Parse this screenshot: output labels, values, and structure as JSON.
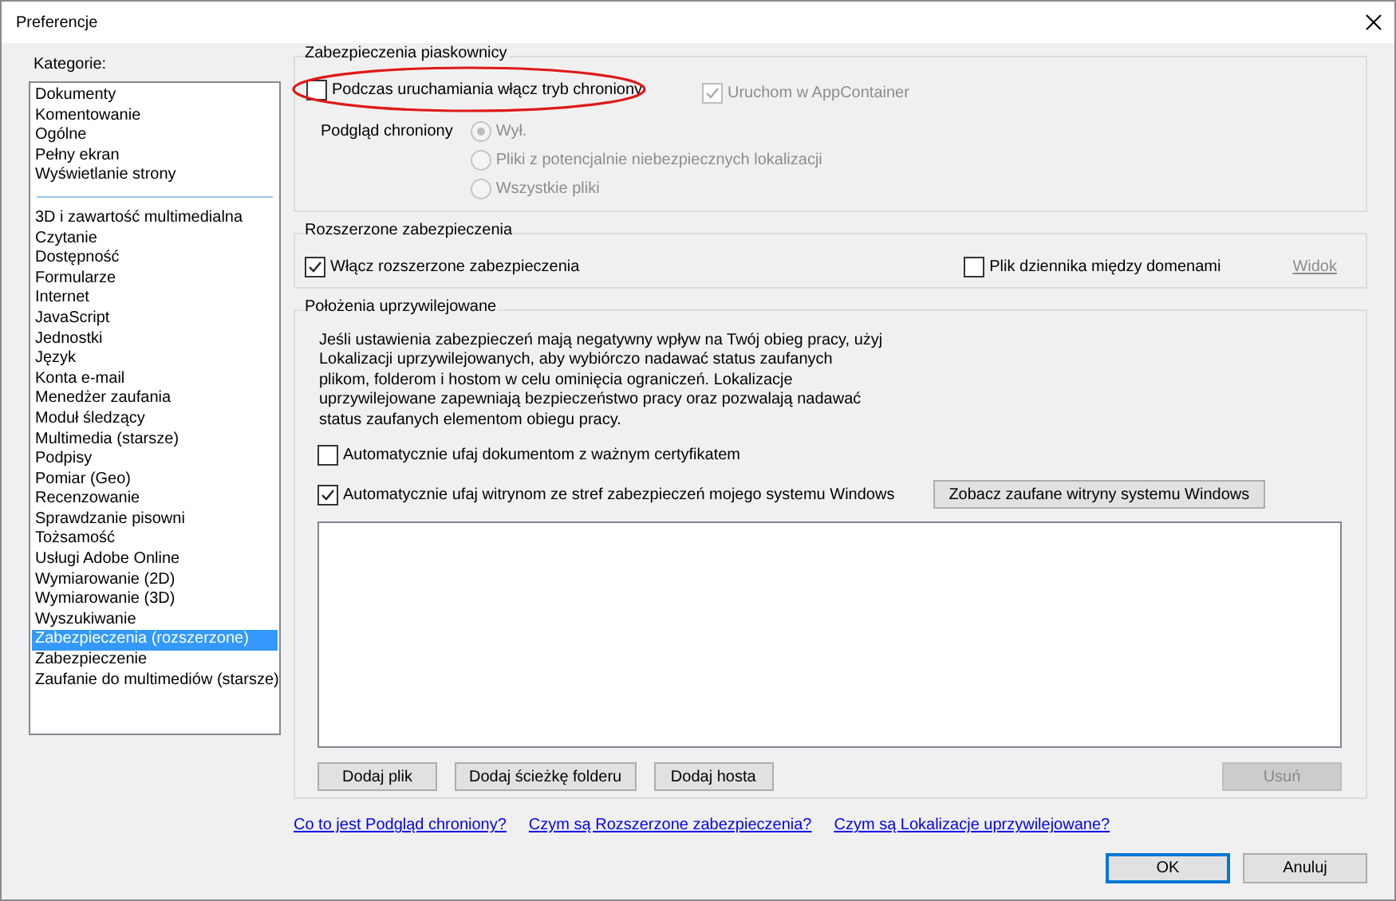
{
  "window": {
    "title": "Preferencje"
  },
  "categories": {
    "label": "Kategorie:",
    "groups": [
      [
        {
          "label": "Dokumenty",
          "selected": false
        },
        {
          "label": "Komentowanie",
          "selected": false
        },
        {
          "label": "Ogólne",
          "selected": false
        },
        {
          "label": "Pełny ekran",
          "selected": false
        },
        {
          "label": "Wyświetlanie strony",
          "selected": false
        }
      ],
      [
        {
          "label": "3D i zawartość multimedialna",
          "selected": false
        },
        {
          "label": "Czytanie",
          "selected": false
        },
        {
          "label": "Dostępność",
          "selected": false
        },
        {
          "label": "Formularze",
          "selected": false
        },
        {
          "label": "Internet",
          "selected": false
        },
        {
          "label": "JavaScript",
          "selected": false
        },
        {
          "label": "Jednostki",
          "selected": false
        },
        {
          "label": "Język",
          "selected": false
        },
        {
          "label": "Konta e-mail",
          "selected": false
        },
        {
          "label": "Menedżer zaufania",
          "selected": false
        },
        {
          "label": "Moduł śledzący",
          "selected": false
        },
        {
          "label": "Multimedia (starsze)",
          "selected": false
        },
        {
          "label": "Podpisy",
          "selected": false
        },
        {
          "label": "Pomiar (Geo)",
          "selected": false
        },
        {
          "label": "Recenzowanie",
          "selected": false
        },
        {
          "label": "Sprawdzanie pisowni",
          "selected": false
        },
        {
          "label": "Tożsamość",
          "selected": false
        },
        {
          "label": "Usługi Adobe Online",
          "selected": false
        },
        {
          "label": "Wymiarowanie (2D)",
          "selected": false
        },
        {
          "label": "Wymiarowanie (3D)",
          "selected": false
        },
        {
          "label": "Wyszukiwanie",
          "selected": false
        },
        {
          "label": "Zabezpieczenia (rozszerzone)",
          "selected": true
        },
        {
          "label": "Zabezpieczenie",
          "selected": false
        },
        {
          "label": "Zaufanie do multimediów (starsze)",
          "selected": false
        }
      ]
    ]
  },
  "sandbox": {
    "title": "Zabezpieczenia piaskownicy",
    "protected_mode": {
      "label": "Podczas uruchamiania włącz tryb chroniony",
      "checked": false,
      "disabled": false,
      "highlighted": true
    },
    "appcontainer": {
      "label": "Uruchom w AppContainer",
      "checked": true,
      "disabled": true
    },
    "preview": {
      "label": "Podgląd chroniony",
      "options": [
        {
          "label": "Wył.",
          "selected": true,
          "disabled": true
        },
        {
          "label": "Pliki z potencjalnie niebezpiecznych lokalizacji",
          "selected": false,
          "disabled": true
        },
        {
          "label": "Wszystkie pliki",
          "selected": false,
          "disabled": true
        }
      ]
    }
  },
  "enhanced": {
    "title": "Rozszerzone zabezpieczenia",
    "enable": {
      "label": "Włącz rozszerzone zabezpieczenia",
      "checked": true,
      "disabled": false
    },
    "log": {
      "label": "Plik dziennika między domenami",
      "checked": false,
      "disabled": false
    },
    "view_link": {
      "label": "Widok",
      "disabled": true
    }
  },
  "privileged": {
    "title": "Położenia uprzywilejowane",
    "description": "Jeśli ustawienia zabezpieczeń mają negatywny wpływ na Twój obieg pracy, użyj Lokalizacji uprzywilejowanych, aby wybiórczo nadawać status zaufanych plikom, folderom i hostom w celu ominięcia ograniczeń. Lokalizacje uprzywilejowane zapewniają bezpieczeństwo pracy oraz pozwalają nadawać status zaufanych elementom obiegu pracy.",
    "certified": {
      "label": "Automatycznie ufaj dokumentom z ważnym certyfikatem",
      "checked": false,
      "disabled": false
    },
    "windows_zones": {
      "label": "Automatycznie ufaj witrynom ze stref zabezpieczeń mojego systemu Windows",
      "checked": true,
      "disabled": false
    },
    "windows_button": "Zobacz zaufane witryny systemu Windows",
    "buttons": [
      {
        "label": "Dodaj plik",
        "disabled": false
      },
      {
        "label": "Dodaj ścieżkę folderu",
        "disabled": false
      },
      {
        "label": "Dodaj hosta",
        "disabled": false
      },
      {
        "label": "Usuń",
        "disabled": true
      }
    ]
  },
  "links": [
    "Co to jest Podgląd chroniony?",
    "Czym są Rozszerzone zabezpieczenia?",
    "Czym są Lokalizacje uprzywilejowane?"
  ],
  "buttons": [
    {
      "label": "OK",
      "default": true
    },
    {
      "label": "Anuluj",
      "default": false
    }
  ]
}
